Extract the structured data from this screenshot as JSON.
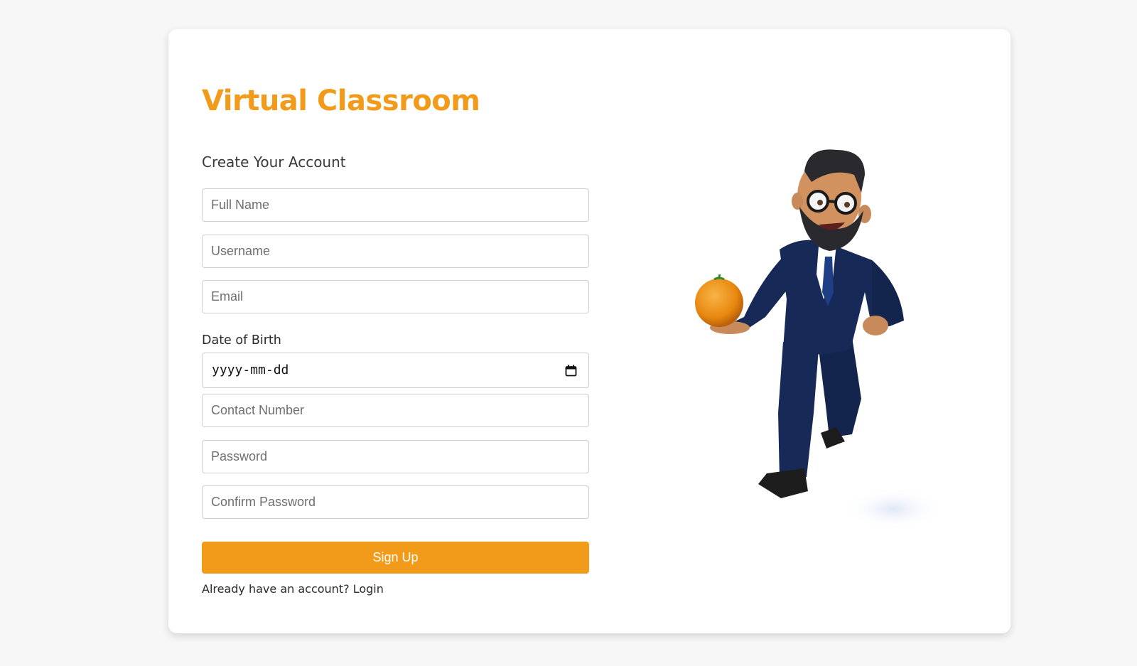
{
  "app": {
    "title": "Virtual Classroom"
  },
  "form": {
    "subtitle": "Create Your Account",
    "fields": {
      "full_name": {
        "placeholder": "Full Name",
        "value": ""
      },
      "username": {
        "placeholder": "Username",
        "value": ""
      },
      "email": {
        "placeholder": "Email",
        "value": ""
      },
      "date_of_birth": {
        "label": "Date of Birth",
        "display": "yyyy-mm-dd"
      },
      "contact_number": {
        "placeholder": "Contact Number",
        "value": ""
      },
      "password": {
        "placeholder": "Password",
        "value": ""
      },
      "confirm_password": {
        "placeholder": "Confirm Password",
        "value": ""
      }
    },
    "submit_label": "Sign Up",
    "login_prompt": "Already have an account?",
    "login_link": "Login"
  },
  "illustration": {
    "icon": "cartoon-businessman-with-orange"
  },
  "colors": {
    "accent": "#f29b1a",
    "background": "#f7f7f7",
    "card": "#ffffff",
    "input_border": "#cfcfcf"
  }
}
